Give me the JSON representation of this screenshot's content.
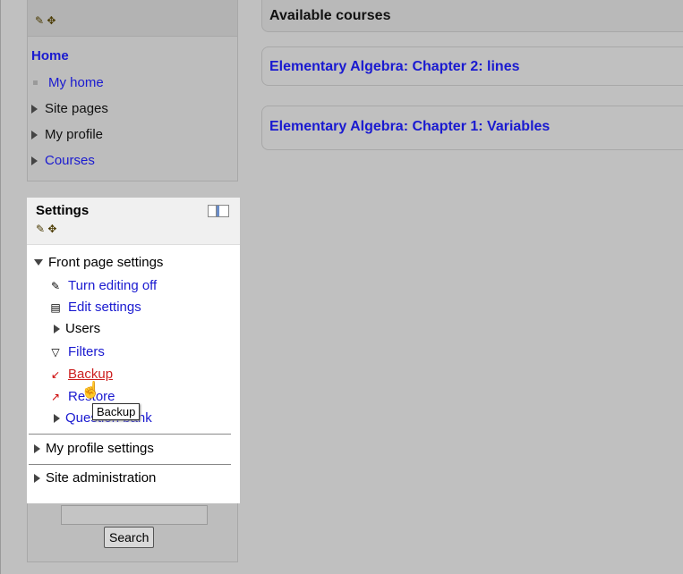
{
  "nav": {
    "home": "Home",
    "items": [
      {
        "label": "My home",
        "kind": "bullet",
        "link": true
      },
      {
        "label": "Site pages",
        "kind": "collapsed",
        "link": false
      },
      {
        "label": "My profile",
        "kind": "collapsed",
        "link": false
      },
      {
        "label": "Courses",
        "kind": "collapsed",
        "link": true
      }
    ]
  },
  "settings": {
    "title": "Settings",
    "front_page": "Front page settings",
    "items": [
      {
        "label": "Turn editing off",
        "icon": "pencil-icon",
        "link": true
      },
      {
        "label": "Edit settings",
        "icon": "document-icon",
        "link": true
      },
      {
        "label": "Users",
        "icon": "expand-arrow-icon",
        "link": false
      },
      {
        "label": "Filters",
        "icon": "filter-icon",
        "link": true
      },
      {
        "label": "Backup",
        "icon": "backup-icon",
        "link": true,
        "active": true
      },
      {
        "label": "Restore",
        "icon": "restore-icon",
        "link": true
      },
      {
        "label": "Question bank",
        "icon": "expand-arrow-icon",
        "link": true
      }
    ],
    "my_profile_settings": "My profile settings",
    "site_administration": "Site administration"
  },
  "search": {
    "button": "Search",
    "placeholder": ""
  },
  "main": {
    "available_courses": "Available courses",
    "courses": [
      "Elementary Algebra: Chapter 2: lines",
      "Elementary Algebra: Chapter 1: Variables"
    ]
  },
  "tooltip": "Backup"
}
